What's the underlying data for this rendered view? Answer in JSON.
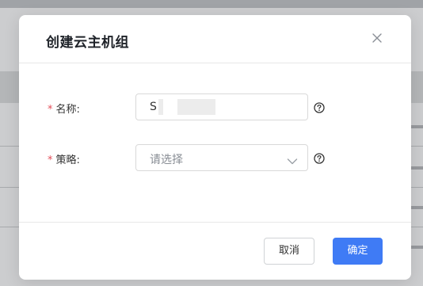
{
  "dialog": {
    "title": "创建云主机组",
    "close_icon": "close-icon"
  },
  "form": {
    "name": {
      "required_mark": "*",
      "label": "名称:",
      "value": "S",
      "help_icon": "question-circle-icon"
    },
    "strategy": {
      "required_mark": "*",
      "label": "策略:",
      "placeholder": "请选择",
      "dropdown_icon": "chevron-down-icon",
      "help_icon": "question-circle-icon"
    }
  },
  "footer": {
    "cancel_label": "取消",
    "ok_label": "确定"
  },
  "colors": {
    "primary": "#3f7bf5",
    "required": "#e34d59"
  }
}
